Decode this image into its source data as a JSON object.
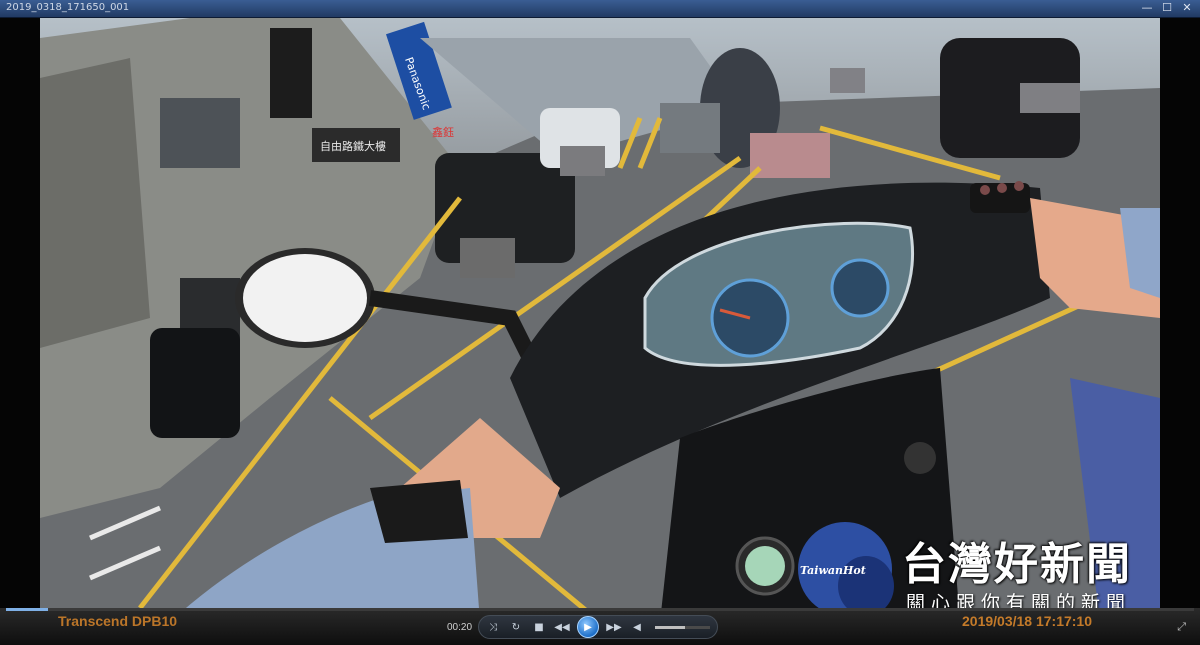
{
  "window": {
    "title": "2019_0318_171650_001",
    "controls": {
      "minimize": "—",
      "maximize": "☐",
      "close": "✕"
    }
  },
  "video": {
    "camera_brand": "Transcend DPB10",
    "timestamp": "2019/03/18 17:17:10",
    "scene_signs": [
      "自由路鐵大樓",
      "Panasonic",
      "鑫鈺"
    ]
  },
  "player": {
    "elapsed": "00:20",
    "buttons": {
      "shuffle": "⤨",
      "repeat": "↻",
      "stop": "■",
      "previous": "◀◀",
      "play": "▶",
      "next": "▶▶",
      "mute": "◀"
    },
    "expand": "⤢",
    "seek_fraction": 0.035,
    "volume_fraction": 0.55
  },
  "watermark": {
    "name_zh": "台灣好新聞",
    "name_en": "TaiwanHot",
    "slogan": "關心跟你有關的新聞",
    "circle_color": "#2d4fa3"
  },
  "colors": {
    "titlebar": "#2f4f85",
    "accent_timestamp": "#d7852b",
    "road_marking": "#e2b93b"
  }
}
